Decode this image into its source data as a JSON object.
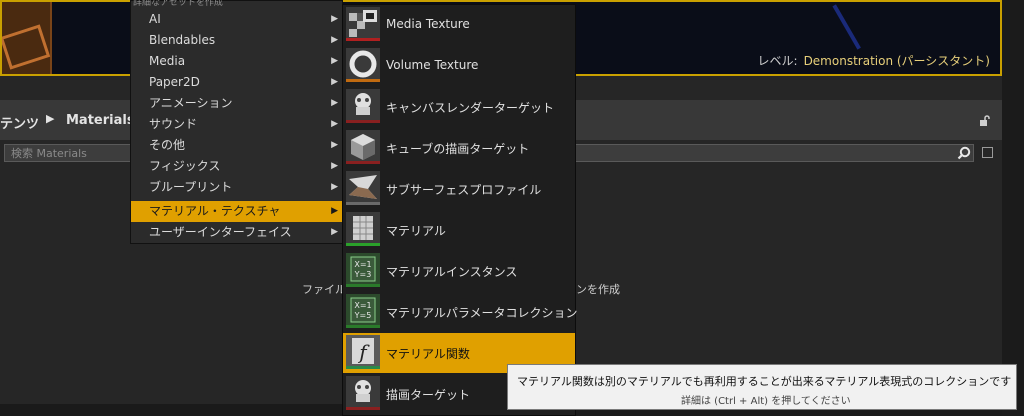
{
  "viewport": {
    "level_prefix": "レベル:",
    "level_name": "Demonstration (パーシスタント)"
  },
  "content_browser": {
    "breadcrumb_root": "テンツ",
    "breadcrumb_current": "Materials",
    "search_placeholder": "検索 Materials",
    "empty_text_left": "ファイル",
    "empty_text_right": "ンを作成"
  },
  "category_menu": {
    "header": "詳細なアセットを作成",
    "items": [
      {
        "label": "AI",
        "active": false
      },
      {
        "label": "Blendables",
        "active": false
      },
      {
        "label": "Media",
        "active": false
      },
      {
        "label": "Paper2D",
        "active": false
      },
      {
        "label": "アニメーション",
        "active": false
      },
      {
        "label": "サウンド",
        "active": false
      },
      {
        "label": "その他",
        "active": false
      },
      {
        "label": "フィジックス",
        "active": false
      },
      {
        "label": "ブループリント",
        "active": false
      },
      {
        "label": "マテリアル・テクスチャ",
        "active": true
      },
      {
        "label": "ユーザーインターフェイス",
        "active": false
      }
    ]
  },
  "asset_menu": {
    "items": [
      {
        "label": "Media Texture",
        "icon": "media-texture-icon",
        "accent": "#b02020"
      },
      {
        "label": "Volume Texture",
        "icon": "volume-texture-icon",
        "accent": "#c06a10"
      },
      {
        "label": "キャンバスレンダーターゲット",
        "icon": "canvas-render-target-icon",
        "accent": "#8a2020"
      },
      {
        "label": "キューブの描画ターゲット",
        "icon": "cube-render-target-icon",
        "accent": "#8a2020"
      },
      {
        "label": "サブサーフェスプロファイル",
        "icon": "subsurface-profile-icon",
        "accent": "#6a6a6a"
      },
      {
        "label": "マテリアル",
        "icon": "material-icon",
        "accent": "#2aa02a"
      },
      {
        "label": "マテリアルインスタンス",
        "icon": "material-instance-icon",
        "accent": "#2a7a2a"
      },
      {
        "label": "マテリアルパラメータコレクション",
        "icon": "material-parameter-collection-icon",
        "accent": "#2a7a2a"
      },
      {
        "label": "マテリアル関数",
        "icon": "material-function-icon",
        "accent": "#2a8a4a",
        "active": true
      },
      {
        "label": "描画ターゲット",
        "icon": "render-target-icon",
        "accent": "#8a2020"
      }
    ]
  },
  "tooltip": {
    "main": "マテリアル関数は別のマテリアルでも再利用することが出来るマテリアル表現式のコレクションです",
    "sub": "詳細は (Ctrl + Alt) を押してください"
  },
  "colors": {
    "highlight": "#e0a000",
    "menu_bg": "#2b2b2b",
    "submenu_bg": "#1e1e1e"
  }
}
